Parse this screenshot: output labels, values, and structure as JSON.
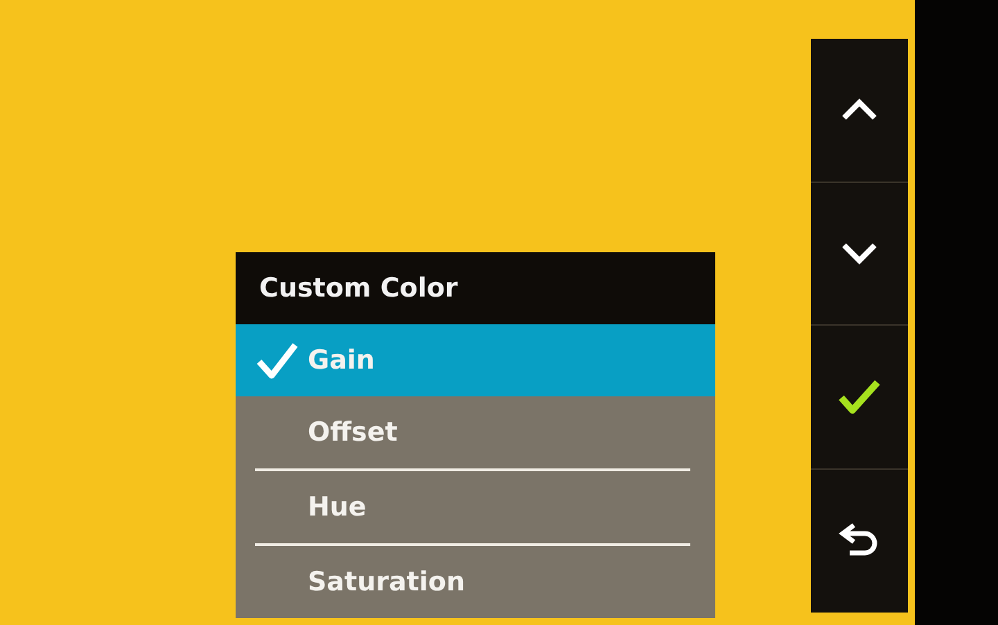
{
  "menu": {
    "title": "Custom Color",
    "items": [
      {
        "label": "Gain",
        "selected": true
      },
      {
        "label": "Offset",
        "selected": false
      },
      {
        "label": "Hue",
        "selected": false
      },
      {
        "label": "Saturation",
        "selected": false
      }
    ]
  },
  "buttons": [
    {
      "kind": "up"
    },
    {
      "kind": "down"
    },
    {
      "kind": "confirm"
    },
    {
      "kind": "back"
    }
  ]
}
